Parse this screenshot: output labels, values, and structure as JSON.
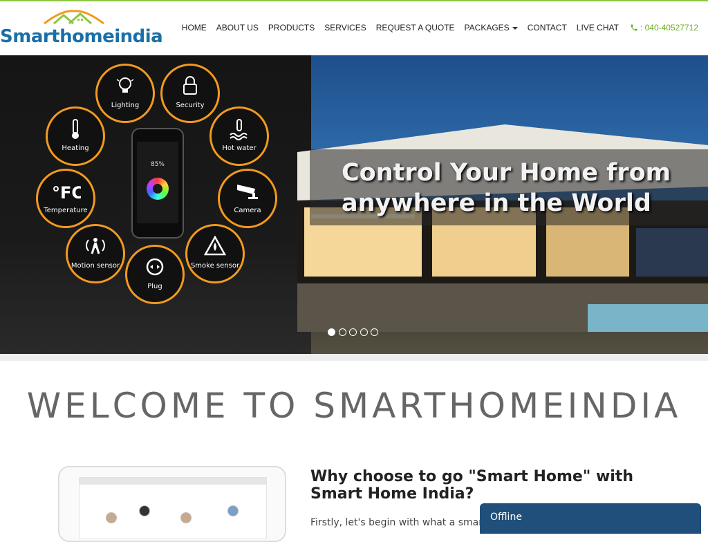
{
  "brand": {
    "logo_text": "Smarthomeindia",
    "accent": "#8cc63f",
    "primary": "#1a6fa8"
  },
  "nav": {
    "items": [
      "HOME",
      "ABOUT US",
      "PRODUCTS",
      "SERVICES",
      "REQUEST A QUOTE",
      "PACKAGES",
      "CONTACT",
      "LIVE CHAT"
    ],
    "phone": ": 040-40527712"
  },
  "hero": {
    "caption": "Control Your Home from anywhere in the World",
    "phone_display": "85%",
    "features": [
      {
        "label": "Lighting",
        "icon": "bulb-icon"
      },
      {
        "label": "Security",
        "icon": "lock-icon"
      },
      {
        "label": "Heating",
        "icon": "thermometer-icon"
      },
      {
        "label": "Hot water",
        "icon": "hot-water-icon"
      },
      {
        "label": "Temperature",
        "icon": "temperature-icon"
      },
      {
        "label": "Camera",
        "icon": "camera-icon"
      },
      {
        "label": "Motion sensor",
        "icon": "motion-sensor-icon"
      },
      {
        "label": "Plug",
        "icon": "plug-icon"
      },
      {
        "label": "Smoke sensor",
        "icon": "smoke-sensor-icon"
      }
    ],
    "slide_count": 5,
    "active_slide": 1
  },
  "content": {
    "welcome": "WELCOME TO SMARTHOMEINDIA",
    "why_title": "Why choose to go \"Smart Home\" with Smart Home India?",
    "why_body": "Firstly, let's begin with what a smart"
  },
  "chat": {
    "status": "Offline"
  }
}
